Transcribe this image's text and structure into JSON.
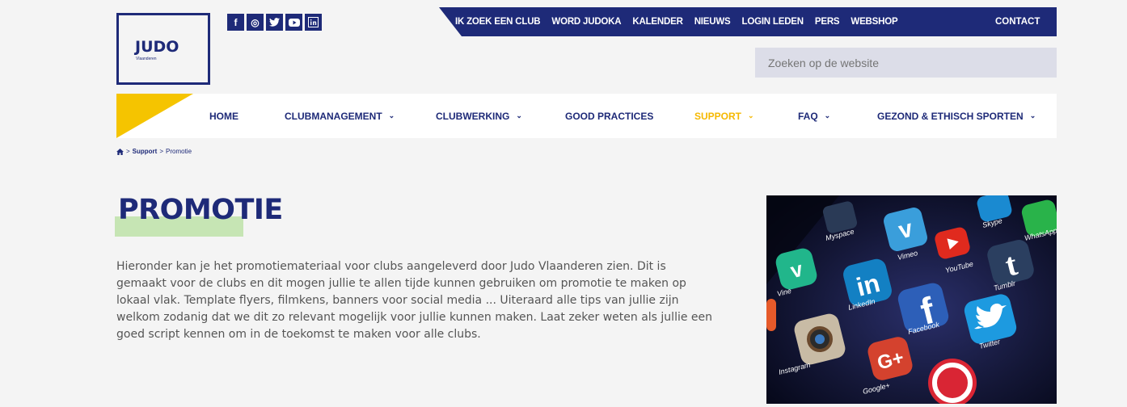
{
  "logo": {
    "name": "JUDO",
    "sub": "Vlaanderen"
  },
  "social": [
    {
      "icon": "facebook-icon",
      "glyph": "f"
    },
    {
      "icon": "instagram-icon",
      "glyph": "◎"
    },
    {
      "icon": "twitter-icon",
      "glyph": "✔"
    },
    {
      "icon": "youtube-icon",
      "glyph": "▶"
    },
    {
      "icon": "linkedin-icon",
      "glyph": "in"
    }
  ],
  "topnav": [
    "IK ZOEK EEN CLUB",
    "WORD JUDOKA",
    "KALENDER",
    "NIEUWS",
    "LOGIN LEDEN",
    "PERS",
    "WEBSHOP"
  ],
  "topnav_contact": "CONTACT",
  "search": {
    "placeholder": "Zoeken op de website"
  },
  "mainnav": [
    {
      "label": "HOME",
      "dropdown": false
    },
    {
      "label": "CLUBMANAGEMENT",
      "dropdown": true
    },
    {
      "label": "CLUBWERKING",
      "dropdown": true
    },
    {
      "label": "GOOD PRACTICES",
      "dropdown": false
    },
    {
      "label": "SUPPORT",
      "dropdown": true,
      "active": true
    },
    {
      "label": "FAQ",
      "dropdown": true
    },
    {
      "label": "GEZOND & ETHISCH SPORTEN",
      "dropdown": true
    }
  ],
  "breadcrumb": {
    "home_icon": "home-icon",
    "sep": ">",
    "items": [
      "Support",
      "Promotie"
    ]
  },
  "page": {
    "title": "PROMOTIE",
    "intro": "Hieronder kan je het promotiemateriaal voor clubs aangeleverd door Judo Vlaanderen zien. Dit is gemaakt voor de clubs en dit mogen jullie te allen tijde kunnen gebruiken om promotie te maken op lokaal vlak. Template flyers, filmkens, banners voor social media ...  Uiteraard alle tips van jullie zijn welkom zodanig dat we dit zo relevant mogelijk voor jullie kunnen maken. Laat zeker weten als jullie een goed script kennen om in de toekomst te maken voor alle clubs."
  },
  "photo_labels": [
    "Vimeo",
    "YouTube",
    "Skype",
    "WhatsApp",
    "Myspace",
    "Vine",
    "LinkedIn",
    "Tumblr",
    "Facebook",
    "Twitter",
    "Instagram",
    "Google+"
  ],
  "colors": {
    "navy": "#1e2a78",
    "yellow": "#f5c400",
    "highlight": "#c6e5b4",
    "search_bg": "#dcdde8"
  }
}
